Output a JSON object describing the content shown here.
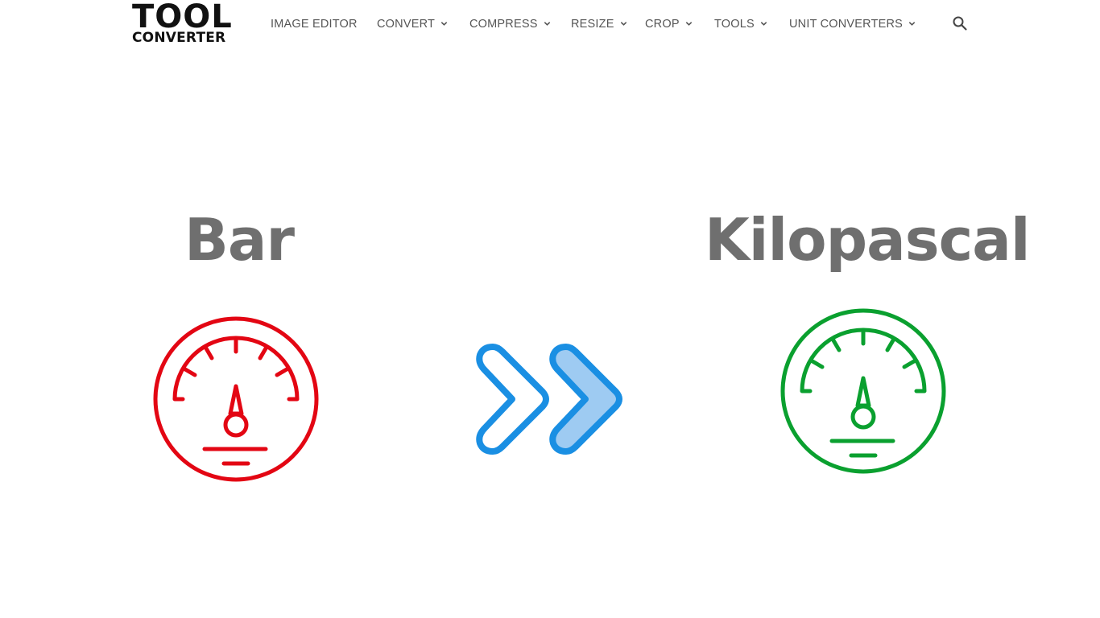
{
  "header": {
    "logo": {
      "line1": "TOOL",
      "line2": "CONVERTER"
    },
    "nav": [
      {
        "label": "IMAGE EDITOR",
        "has_dropdown": false
      },
      {
        "label": "CONVERT",
        "has_dropdown": true
      },
      {
        "label": "COMPRESS",
        "has_dropdown": true
      },
      {
        "label": "RESIZE",
        "has_dropdown": true
      },
      {
        "label": "CROP",
        "has_dropdown": true
      },
      {
        "label": "TOOLS",
        "has_dropdown": true
      },
      {
        "label": "UNIT CONVERTERS",
        "has_dropdown": true
      }
    ],
    "search_icon": "search-icon"
  },
  "converter": {
    "from_unit": {
      "label": "Bar",
      "icon": "pressure-gauge-icon",
      "color": "#e30613"
    },
    "arrow": {
      "icon": "double-chevron-right-icon",
      "stroke_color": "#1a8fe3",
      "fill_color": "#9ecbf2"
    },
    "to_unit": {
      "label": "Kilopascal",
      "icon": "pressure-gauge-icon",
      "color": "#0aa02f"
    }
  },
  "colors": {
    "text_dark": "#111111",
    "nav_text": "#555555",
    "unit_title": "#6f6f6f",
    "background": "#ffffff"
  }
}
